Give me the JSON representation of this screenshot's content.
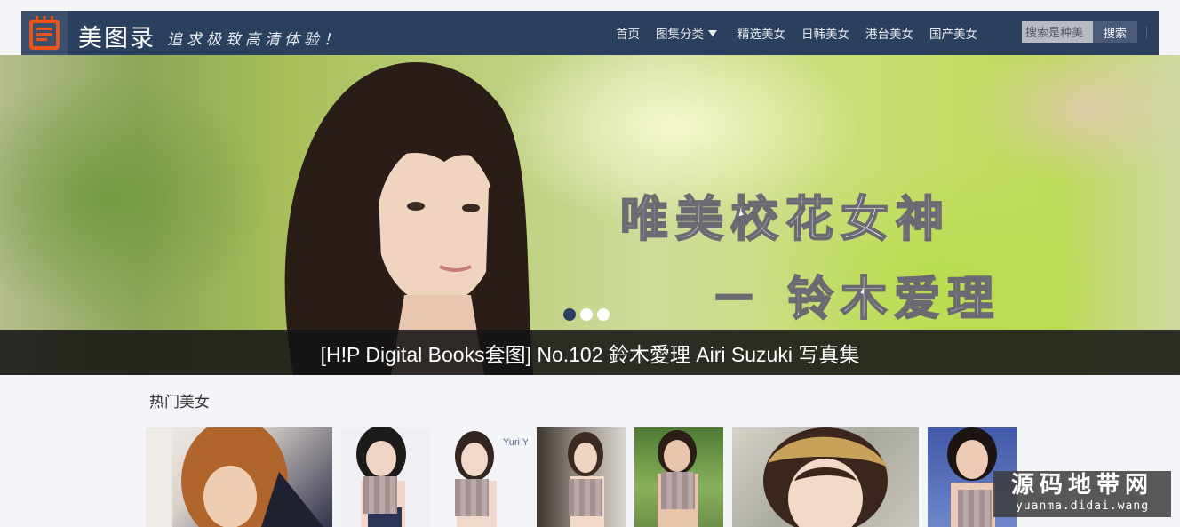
{
  "header": {
    "logo_icon": "notebook-icon",
    "site_title": "美图录",
    "slogan": "追求极致高清体验！",
    "nav": [
      {
        "label": "首页"
      },
      {
        "label": "图集分类",
        "icon": "caret-down-icon"
      },
      {
        "label": "精选美女"
      },
      {
        "label": "日韩美女"
      },
      {
        "label": "港台美女"
      },
      {
        "label": "国产美女"
      }
    ],
    "search": {
      "placeholder": "搜索是种美",
      "button_label": "搜索"
    }
  },
  "banner": {
    "overlay_line1": "唯美校花女神",
    "overlay_line2": "－  铃木爱理",
    "caption": "[H!P Digital Books套图] No.102 鈴木愛理 Airi Suzuki 写真集",
    "dots": [
      true,
      false,
      false
    ]
  },
  "hot_section": {
    "title": "热门美女",
    "thumbnails": [
      {
        "name": "thumb-1"
      },
      {
        "name": "thumb-2"
      },
      {
        "name": "thumb-3",
        "text": "Yuri Yam"
      },
      {
        "name": "thumb-4"
      },
      {
        "name": "thumb-5"
      },
      {
        "name": "thumb-6"
      },
      {
        "name": "thumb-7"
      }
    ]
  },
  "watermark": {
    "logo": "源码地带网",
    "url": "yuanma.didai.wang"
  },
  "colors": {
    "navbar": "#2b3f5e",
    "accent": "#e8541c",
    "caption_bg": "#1a1a1a"
  }
}
